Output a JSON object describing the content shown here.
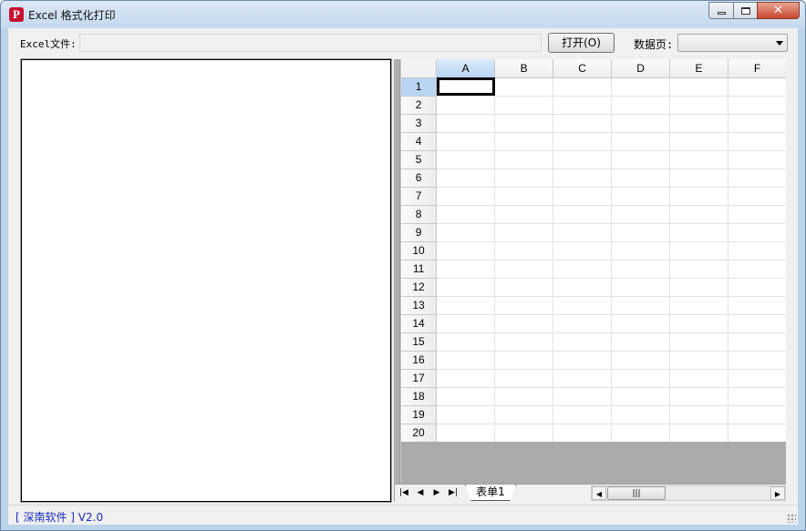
{
  "window": {
    "title": "Excel 格式化打印",
    "app_icon_letter": "P",
    "controls": {
      "minimize": "minimize",
      "maximize": "maximize",
      "close": "✕"
    }
  },
  "toolbar": {
    "file_label": "Excel文件:",
    "file_value": "",
    "open_button_label": "打开(O)",
    "sheet_label": "数据页:",
    "sheet_value": ""
  },
  "grid": {
    "columns": [
      "A",
      "B",
      "C",
      "D",
      "E",
      "F"
    ],
    "rows": [
      "1",
      "2",
      "3",
      "4",
      "5",
      "6",
      "7",
      "8",
      "9",
      "10",
      "11",
      "12",
      "13",
      "14",
      "15",
      "16",
      "17",
      "18",
      "19",
      "20"
    ],
    "active_cell": "A1"
  },
  "sheet_tabs": {
    "nav": [
      "first-sheet",
      "prev-sheet",
      "next-sheet",
      "last-sheet"
    ],
    "tabs": [
      "表单1"
    ],
    "scroll_thumb": "|||"
  },
  "status": {
    "text": "[ 深南软件 ]  V2.0"
  },
  "colors": {
    "title_bar": "#c4d9ef",
    "status_text": "#1a2cbf",
    "selected_header": "#b9d5f3",
    "grid_background": "#ababab"
  }
}
